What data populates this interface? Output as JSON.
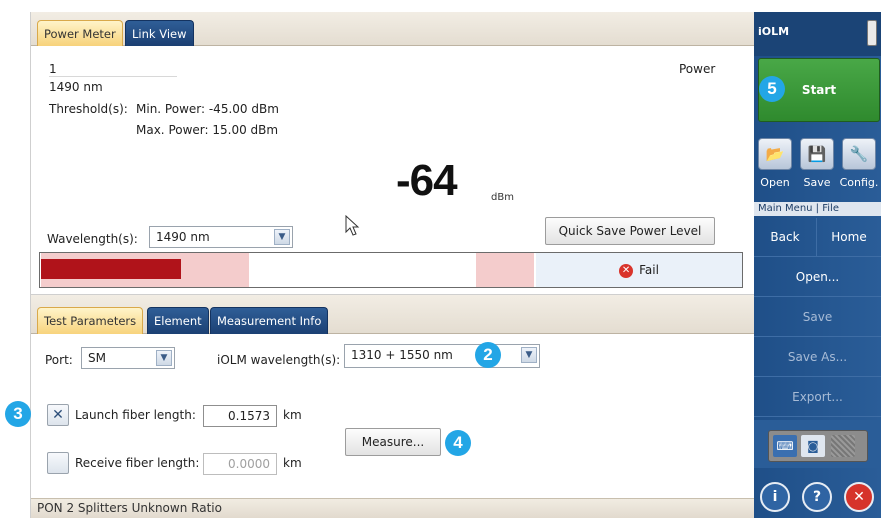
{
  "tabs_top": [
    "Power Meter",
    "Link View"
  ],
  "power_meter": {
    "fiber_number": "1",
    "wavelength_line": "1490 nm",
    "power_label": "Power",
    "threshold_label": "Threshold(s):",
    "min_power": "Min. Power: -45.00 dBm",
    "max_power": "Max. Power: 15.00 dBm",
    "value": "-64",
    "unit": "dBm",
    "wavelength_select_label": "Wavelength(s):",
    "wavelength_select_value": "1490 nm",
    "quick_save_label": "Quick Save Power Level",
    "level_fraction": 0.2,
    "status": "Fail"
  },
  "tabs_bottom": [
    "Test Parameters",
    "Element",
    "Measurement Info"
  ],
  "test_parameters": {
    "port_label": "Port:",
    "port_value": "SM",
    "iolm_wavelength_label": "iOLM wavelength(s):",
    "iolm_wavelength_value": "1310 + 1550 nm",
    "launch_label": "Launch fiber length:",
    "launch_checked": true,
    "launch_value": "0.1573",
    "launch_unit": "km",
    "measure_label": "Measure...",
    "receive_label": "Receive fiber length:",
    "receive_checked": false,
    "receive_value": "0.0000",
    "receive_unit": "km"
  },
  "status_bar": "PON 2 Splitters Unknown Ratio",
  "callouts": [
    "2",
    "3",
    "4",
    "5"
  ],
  "sidebar": {
    "app_name": "iOLM",
    "start_label": "Start",
    "tools": [
      {
        "label": "Open",
        "icon": "folder-icon"
      },
      {
        "label": "Save",
        "icon": "floppy-icon"
      },
      {
        "label": "Config.",
        "icon": "tools-icon"
      }
    ],
    "breadcrumb": "Main Menu | File",
    "back_label": "Back",
    "home_label": "Home",
    "menu_items": [
      {
        "label": "Open...",
        "enabled": true
      },
      {
        "label": "Save",
        "enabled": false
      },
      {
        "label": "Save As...",
        "enabled": false
      },
      {
        "label": "Export...",
        "enabled": false
      }
    ],
    "bottom_buttons": [
      {
        "icon": "info-icon",
        "glyph": "i"
      },
      {
        "icon": "help-icon",
        "glyph": "?"
      },
      {
        "icon": "close-icon",
        "glyph": "✕"
      }
    ]
  },
  "colors": {
    "accent_blue": "#1f4f88",
    "start_green": "#3a9a38",
    "fail_red": "#b0131a",
    "callout": "#23a6e6"
  }
}
